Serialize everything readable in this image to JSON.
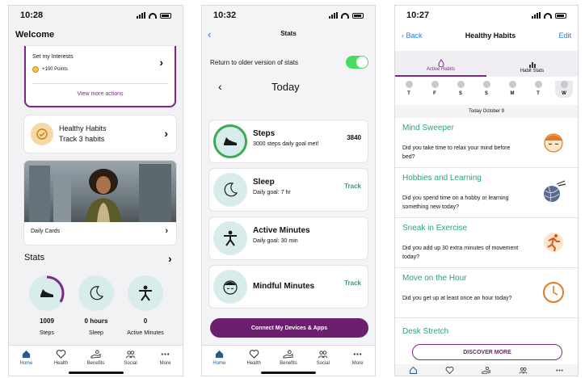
{
  "status_times": [
    "10:28",
    "10:32",
    "10:27"
  ],
  "colors": {
    "brand_purple": "#7a2a83",
    "accent_green": "#2aa37a",
    "link_blue": "#2a7ae4",
    "toggle_on": "#4cd964"
  },
  "tabbar": {
    "home": "Home",
    "health": "Health",
    "benefits": "Benefits",
    "social": "Social",
    "more": "More"
  },
  "screen1": {
    "welcome": "Welcome",
    "interests_title": "Set my Interests",
    "interests_points": "+100 Points",
    "view_more": "View more actions",
    "habits_title": "Healthy Habits",
    "habits_sub": "Track 3 habits",
    "daily_cards": "Daily Cards",
    "stats_title": "Stats",
    "stats": [
      {
        "value": "1009",
        "label": "Steps",
        "progress": 0.34
      },
      {
        "value": "0 hours",
        "label": "Sleep"
      },
      {
        "value": "0",
        "label": "Active Minutes"
      }
    ]
  },
  "screen2": {
    "title": "Stats",
    "toggle_label": "Return to older version of stats",
    "toggle_on": true,
    "day": "Today",
    "items": [
      {
        "name": "Steps",
        "desc": "3000 steps daily goal met!",
        "right": "3840",
        "icon": "shoe-icon"
      },
      {
        "name": "Sleep",
        "desc": "Daily goal: 7 hr",
        "right": "Track",
        "icon": "moon-icon"
      },
      {
        "name": "Active Minutes",
        "desc": "Daily goal: 30 min",
        "right": "",
        "icon": "active-person-icon"
      },
      {
        "name": "Mindful Minutes",
        "desc": "",
        "right": "Track",
        "icon": "face-icon"
      }
    ],
    "connect": "Connect My Devices & Apps"
  },
  "screen3": {
    "back": "Back",
    "title": "Healthy Habits",
    "edit": "Edit",
    "tab_active": "Active Habits",
    "tab_stats": "Habit Stats",
    "days": [
      "T",
      "F",
      "S",
      "S",
      "M",
      "T",
      "W"
    ],
    "date": "Today October 9",
    "habits": [
      {
        "name": "Mind Sweeper",
        "question": "Did you take time to relax your mind before bed?"
      },
      {
        "name": "Hobbies and Learning",
        "question": "Did you spend time on a hobby or learning something new today?"
      },
      {
        "name": "Sneak in Exercise",
        "question": "Did you add up 30 extra minutes of movement today?"
      },
      {
        "name": "Move on the Hour",
        "question": "Did you get up at least once an hour today?"
      },
      {
        "name": "Desk Stretch",
        "question": ""
      }
    ],
    "discover": "DISCOVER MORE"
  }
}
